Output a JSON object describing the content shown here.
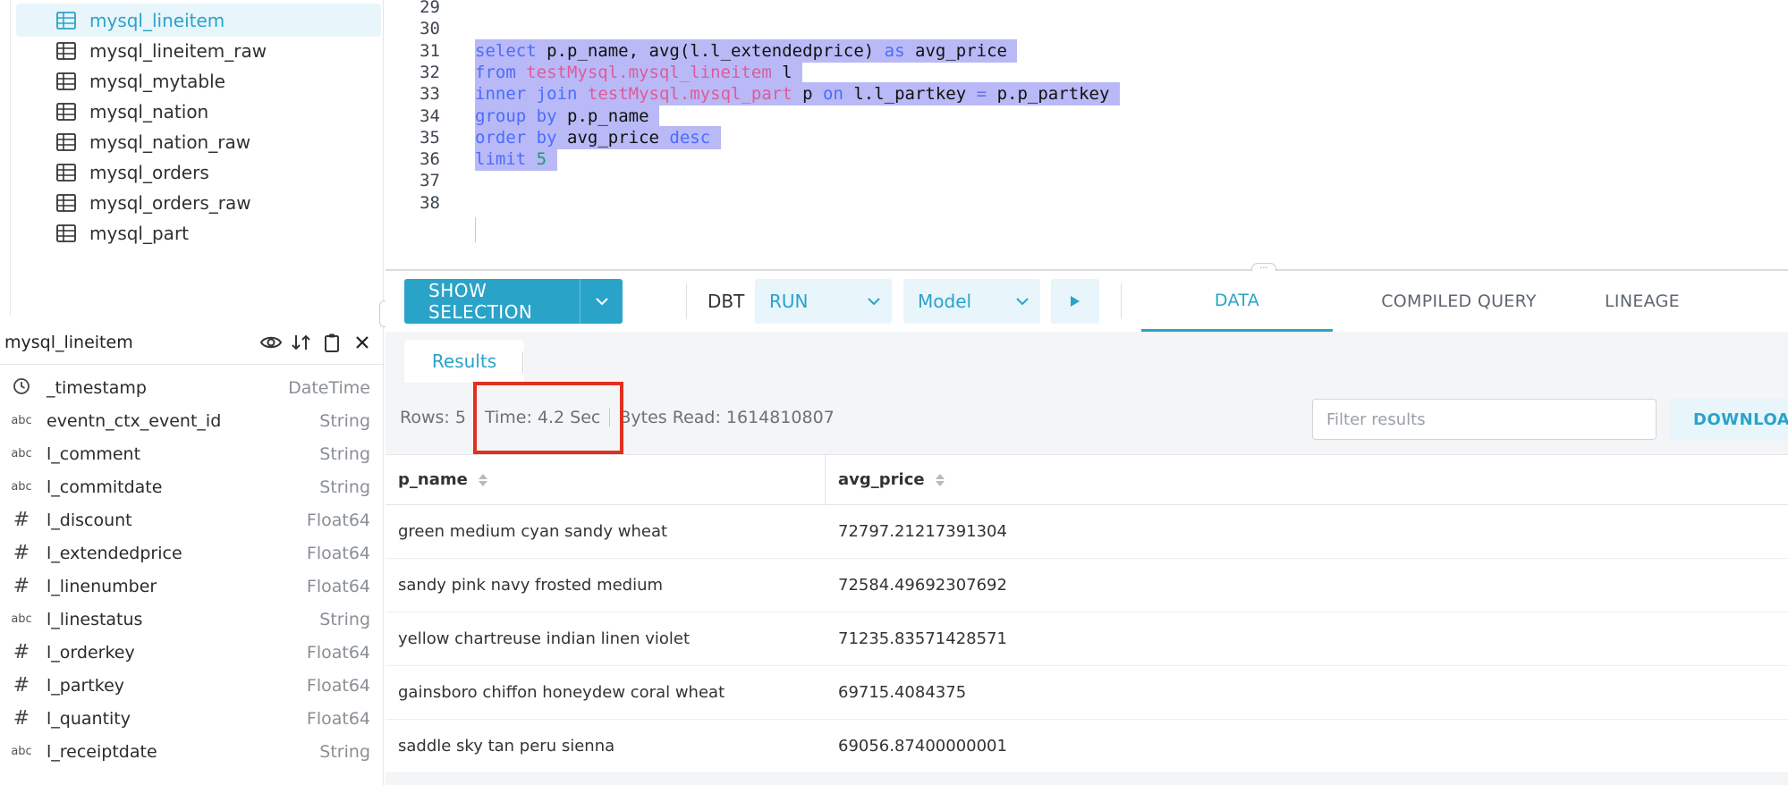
{
  "tree": {
    "items": [
      {
        "label": "mysql_lineitem",
        "active": true
      },
      {
        "label": "mysql_lineitem_raw"
      },
      {
        "label": "mysql_mytable"
      },
      {
        "label": "mysql_nation"
      },
      {
        "label": "mysql_nation_raw"
      },
      {
        "label": "mysql_orders"
      },
      {
        "label": "mysql_orders_raw"
      },
      {
        "label": "mysql_part"
      }
    ]
  },
  "schema": {
    "title": "mysql_lineitem",
    "columns": [
      {
        "icon": "clock-icon",
        "name": "_timestamp",
        "type": "DateTime"
      },
      {
        "icon": "abc",
        "name": "eventn_ctx_event_id",
        "type": "String"
      },
      {
        "icon": "abc",
        "name": "l_comment",
        "type": "String"
      },
      {
        "icon": "abc",
        "name": "l_commitdate",
        "type": "String"
      },
      {
        "icon": "#",
        "name": "l_discount",
        "type": "Float64"
      },
      {
        "icon": "#",
        "name": "l_extendedprice",
        "type": "Float64"
      },
      {
        "icon": "#",
        "name": "l_linenumber",
        "type": "Float64"
      },
      {
        "icon": "abc",
        "name": "l_linestatus",
        "type": "String"
      },
      {
        "icon": "#",
        "name": "l_orderkey",
        "type": "Float64"
      },
      {
        "icon": "#",
        "name": "l_partkey",
        "type": "Float64"
      },
      {
        "icon": "#",
        "name": "l_quantity",
        "type": "Float64"
      },
      {
        "icon": "abc",
        "name": "l_receiptdate",
        "type": "String"
      }
    ]
  },
  "editor": {
    "line_numbers": [
      "29",
      "30",
      "31",
      "32",
      "33",
      "34",
      "35",
      "36",
      "37",
      "38"
    ],
    "lines": [
      "",
      "",
      "select p.p_name, avg(l.l_extendedprice) as avg_price",
      "from testMysql.mysql_lineitem l",
      "inner join testMysql.mysql_part p on l.l_partkey = p.p_partkey",
      "group by p.p_name",
      "order by avg_price desc",
      "limit 5",
      "",
      ""
    ]
  },
  "toolbar": {
    "show_selection_label": "SHOW SELECTION",
    "dbt_label": "DBT",
    "run_label": "RUN",
    "model_label": "Model",
    "tabs": [
      "DATA",
      "COMPILED QUERY",
      "LINEAGE"
    ],
    "active_tab": "DATA"
  },
  "results": {
    "tab_label": "Results",
    "rows_stat": "Rows: 5",
    "time_stat": "Time: 4.2 Sec",
    "bytes_stat": "Bytes Read: 1614810807",
    "filter_placeholder": "Filter results",
    "download_label": "DOWNLOAD",
    "columns": [
      "p_name",
      "avg_price"
    ],
    "rows": [
      [
        "green medium cyan sandy wheat",
        "72797.21217391304"
      ],
      [
        "sandy pink navy frosted medium",
        "72584.49692307692"
      ],
      [
        "yellow chartreuse indian linen violet",
        "71235.83571428571"
      ],
      [
        "gainsboro chiffon honeydew coral wheat",
        "69715.4084375"
      ],
      [
        "saddle sky tan peru sienna",
        "69056.87400000001"
      ]
    ]
  },
  "colors": {
    "accent": "#2aa3c9",
    "highlight": "#e0301e",
    "selection": "#b9b9f7"
  }
}
